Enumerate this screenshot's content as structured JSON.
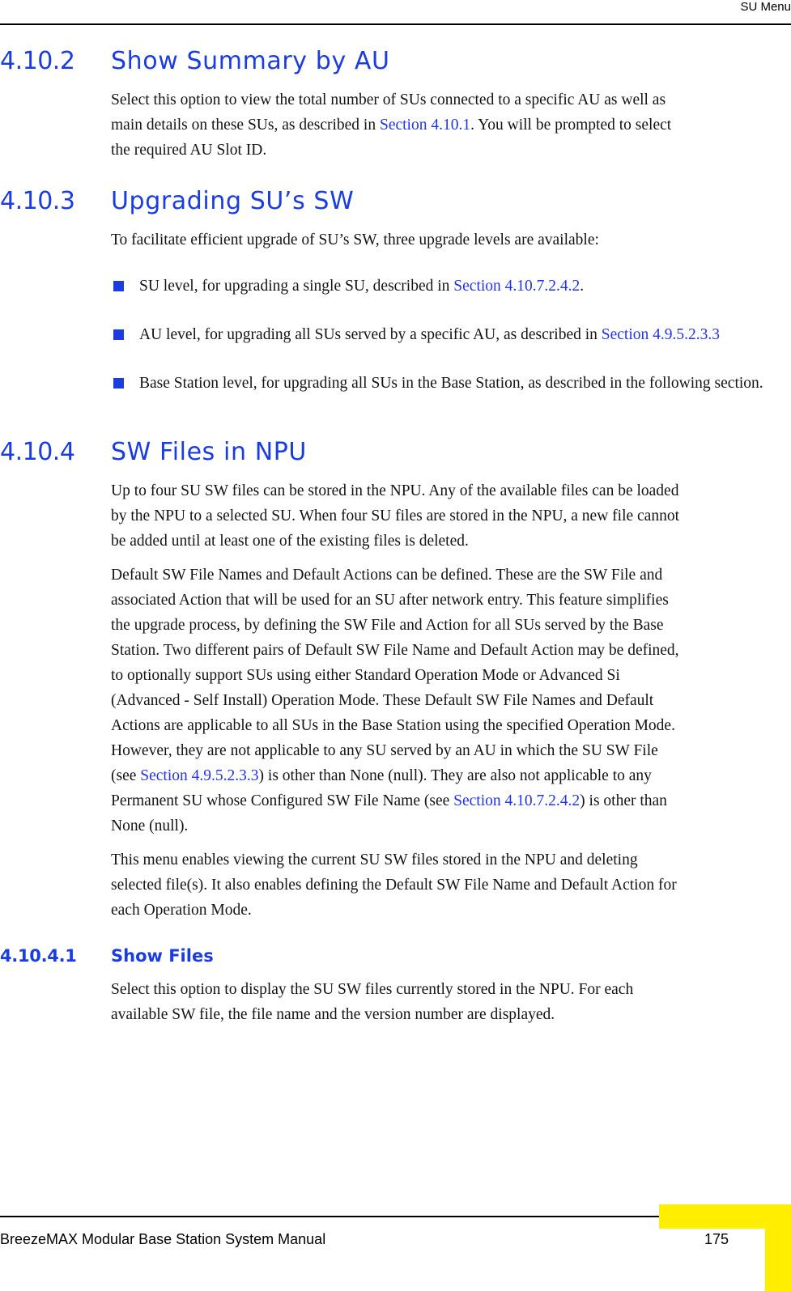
{
  "header": {
    "title": "SU Menu"
  },
  "sections": {
    "s_4_10_2": {
      "number": "4.10.2",
      "title": "Show Summary by AU",
      "para1_a": "Select this option to view the total number of SUs connected to a specific AU as well as main details on these SUs, as described in ",
      "para1_link": "Section 4.10.1",
      "para1_b": ". You will be prompted to select the required AU Slot ID."
    },
    "s_4_10_3": {
      "number": "4.10.3",
      "title": "Upgrading SU’s SW",
      "intro": "To facilitate efficient upgrade of SU’s SW, three upgrade levels are available:",
      "bullets": [
        {
          "text_a": "SU level, for upgrading a single SU, described in ",
          "link": "Section 4.10.7.2.4.2",
          "text_b": "."
        },
        {
          "text_a": "AU level, for upgrading all SUs served by a specific AU, as described in ",
          "link": "Section 4.9.5.2.3.3",
          "text_b": ""
        },
        {
          "text_a": "Base Station level, for upgrading all SUs in the Base Station, as described in the following section.",
          "link": "",
          "text_b": ""
        }
      ]
    },
    "s_4_10_4": {
      "number": "4.10.4",
      "title": "SW Files in NPU",
      "para1": "Up to four SU SW files can be stored in the NPU. Any of the available files can be loaded by the NPU to a selected SU. When four SU files are stored in the NPU, a new file cannot be added until at least one of the existing files is deleted.",
      "para2_a": "Default SW File Names and Default Actions can be defined. These are the SW File and associated Action that will be used for an SU after network entry. This feature simplifies the upgrade process, by defining the SW File and Action for all SUs served by the Base Station. Two different pairs of Default SW File Name and Default Action may be defined, to optionally support SUs using either Standard Operation Mode or Advanced Si (Advanced - Self Install) Operation Mode. These Default SW File Names and Default Actions are applicable to all SUs in the Base Station using the specified Operation Mode. However, they are not applicable to any SU served by an AU in which the SU SW File (see ",
      "para2_link1": "Section 4.9.5.2.3.3",
      "para2_b": ") is other than None (null). They are also not applicable to any Permanent SU whose Configured SW File Name (see ",
      "para2_link2": "Section 4.10.7.2.4.2",
      "para2_c": ") is other than None (null).",
      "para3": "This menu enables viewing the current SU SW files stored in the NPU and deleting selected file(s). It also enables defining the Default SW File Name and Default Action for each Operation Mode."
    },
    "s_4_10_4_1": {
      "number": "4.10.4.1",
      "title": "Show Files",
      "para1": "Select this option to display the SU SW files currently stored in the NPU. For each available SW file, the file name and the version number are displayed."
    }
  },
  "footer": {
    "manual_title": "BreezeMAX Modular Base Station System Manual",
    "page_number": "175"
  },
  "colors": {
    "heading_blue": "#1a3ce0",
    "link_blue": "#2233e8",
    "tab_yellow": "#ffee00",
    "body_text": "#141414"
  }
}
